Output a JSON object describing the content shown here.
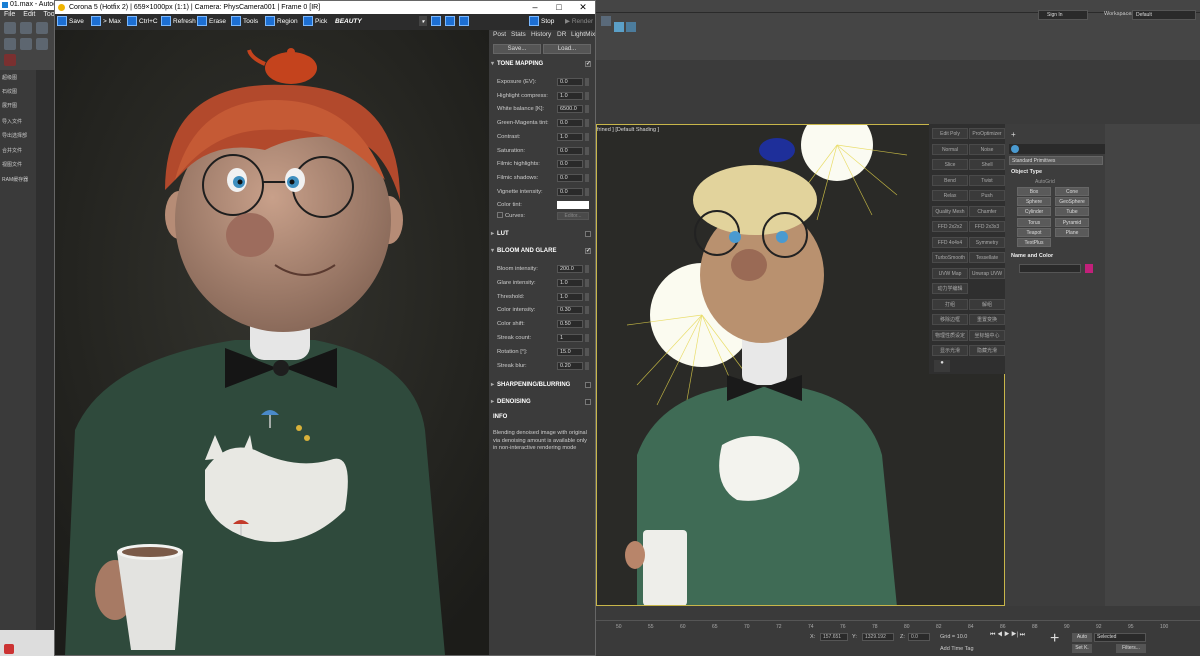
{
  "max": {
    "title": "01.max - Autode",
    "menu": [
      "File",
      "Edit",
      "Tools"
    ],
    "left_panel_items": [
      "超级图",
      "石纹图",
      "展开图",
      "导入文件",
      "导出选择部",
      "合并文件",
      "视图文件",
      "RAM缓存器"
    ],
    "signin": "Sign In",
    "workspaces_label": "Workspaces:",
    "workspace_value": "Default",
    "viewport_label": "frined ] [Default Shading ]",
    "modifiers": [
      [
        "Edit Poly",
        "ProOptimizer"
      ],
      [
        "Normal",
        "Noise"
      ],
      [
        "Slice",
        "Shell"
      ],
      [
        "Bend",
        "Twist"
      ],
      [
        "Relax",
        "Push"
      ],
      [
        "Quality Mesh",
        "Chamfer"
      ],
      [
        "FFD 2x2x2",
        "FFD 2x3x3"
      ],
      [
        "FFD 4x4x4",
        "Symmetry"
      ],
      [
        "TurboSmooth",
        "Tessellate"
      ],
      [
        "UVW Map",
        "Unwrap UVW"
      ],
      [
        "动力学编辑",
        ""
      ],
      [
        "打组",
        "解组"
      ],
      [
        "移除边框",
        "重置变换"
      ],
      [
        "物理性质设定",
        "坐标轴中心"
      ],
      [
        "显示光滑",
        "隐藏光滑"
      ]
    ],
    "command_panel": {
      "dropdown": "Standard Primitives",
      "object_type": "Object Type",
      "autogrid": "AutoGrid",
      "buttons": [
        "Box",
        "Cone",
        "Sphere",
        "GeoSphere",
        "Cylinder",
        "Tube",
        "Torus",
        "Pyramid",
        "Teapot",
        "Plane",
        "TextPlus"
      ],
      "name_and_color": "Name and Color",
      "color_swatch": "#c2207a"
    },
    "timeline_ticks": [
      "50",
      "55",
      "60",
      "65",
      "70",
      "72",
      "74",
      "76",
      "78",
      "80",
      "82",
      "84",
      "86",
      "88",
      "90",
      "92",
      "95",
      "100"
    ],
    "status": {
      "x_label": "X:",
      "x_val": "157.651",
      "y_label": "Y:",
      "y_val": "1329.192",
      "z_label": "Z:",
      "z_val": "0.0",
      "grid": "Grid = 10.0",
      "add_time_tag": "Add Time Tag",
      "auto": "Auto",
      "selected": "Selected",
      "set_k": "Set K.",
      "filters": "Filters..."
    }
  },
  "corona": {
    "title": "Corona 5 (Hotfix 2) | 659×1000px (1:1) | Camera: PhysCamera001 | Frame 0 [IR]",
    "toolbar": {
      "save": "Save",
      "max": "> Max",
      "ctrlc": "Ctrl+C",
      "refresh": "Refresh",
      "erase": "Erase",
      "tools": "Tools",
      "region": "Region",
      "pick": "Pick",
      "pass": "BEAUTY",
      "stop": "Stop",
      "render": "Render"
    },
    "tabs": [
      "Post",
      "Stats",
      "History",
      "DR",
      "LightMix"
    ],
    "save_btn": "Save...",
    "load_btn": "Load...",
    "tone_mapping": {
      "title": "TONE MAPPING",
      "params": [
        {
          "label": "Exposure (EV):",
          "value": "0.0"
        },
        {
          "label": "Highlight compress:",
          "value": "1.0"
        },
        {
          "label": "White balance [K]:",
          "value": "6500.0"
        },
        {
          "label": "Green-Magenta tint:",
          "value": "0.0"
        },
        {
          "label": "Contrast:",
          "value": "1.0"
        },
        {
          "label": "Saturation:",
          "value": "0.0"
        },
        {
          "label": "Filmic highlights:",
          "value": "0.0"
        },
        {
          "label": "Filmic shadows:",
          "value": "0.0"
        },
        {
          "label": "Vignette intensity:",
          "value": "0.0"
        }
      ],
      "color_tint": "Color tint:",
      "curves": "Curves:",
      "editor": "Editor..."
    },
    "lut": "LUT",
    "bloom": {
      "title": "BLOOM AND GLARE",
      "params": [
        {
          "label": "Bloom intensity:",
          "value": "200.0"
        },
        {
          "label": "Glare intensity:",
          "value": "1.0"
        },
        {
          "label": "Threshold:",
          "value": "1.0"
        },
        {
          "label": "Color intensity:",
          "value": "0.30"
        },
        {
          "label": "Color shift:",
          "value": "0.50"
        },
        {
          "label": "Streak count:",
          "value": "1"
        },
        {
          "label": "Rotation [°]:",
          "value": "15.0"
        },
        {
          "label": "Streak blur:",
          "value": "0.20"
        }
      ]
    },
    "sharpening": "SHARPENING/BLURRING",
    "denoising": "DENOISING",
    "info_title": "INFO",
    "info_text": "Blending denoised image with original via denoising amount is available only in non-interactive rendering mode"
  }
}
